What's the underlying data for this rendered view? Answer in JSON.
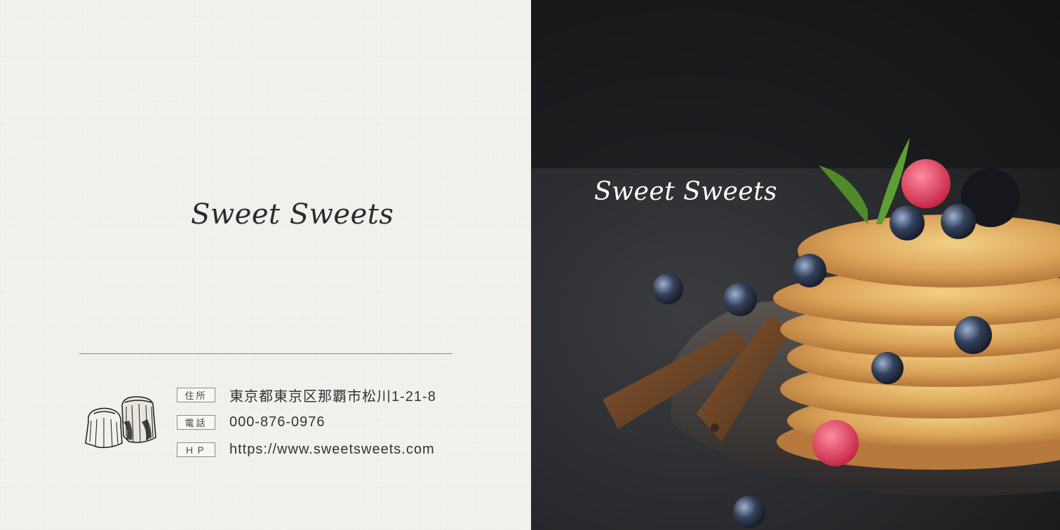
{
  "brand": {
    "name": "Sweet Sweets"
  },
  "contact": {
    "address": {
      "label": "住所",
      "value": "東京都東京区那覇市松川1-21-8"
    },
    "phone": {
      "label": "電話",
      "value": "000-876-0976"
    },
    "website": {
      "label": "ＨＰ",
      "value": "https://www.sweetsweets.com"
    }
  },
  "colors": {
    "text_dark": "#2b2b2b",
    "paper": "#f5f3ef",
    "photo_bg": "#2a2b2e"
  },
  "icons": {
    "canele": "canele-pastry-illustration"
  }
}
